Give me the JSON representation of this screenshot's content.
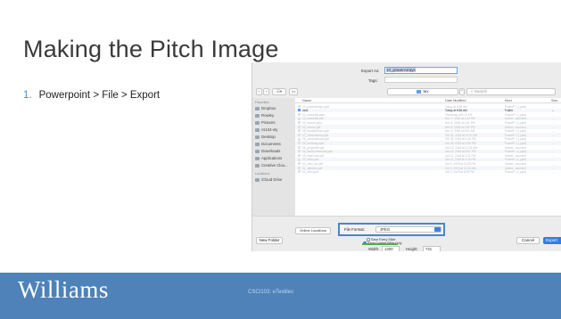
{
  "slide": {
    "title": "Making the Pitch Image",
    "bullet_number": "1.",
    "bullet_text": "Powerpoint > File > Export"
  },
  "dialog": {
    "export_as_label": "Export As:",
    "export_as_value": "10_powerArrays",
    "tags_label": "Tags:",
    "folder": "tex",
    "search_placeholder": "Search",
    "sidebar": {
      "favorites_header": "Favorites",
      "favorites": [
        "Dropbox",
        "Rowley",
        "Pictures",
        "cs134-sty",
        "Desktop",
        "Documents",
        "Downloads",
        "Applications",
        "Creative Clou..."
      ],
      "locations_header": "Locations",
      "locations": [
        "iCloud Drive"
      ]
    },
    "columns": {
      "name": "Name",
      "date": "Date Modified",
      "kind": "Kind",
      "size": "Size"
    },
    "files": [
      {
        "name": "10_powerArrays.pptx",
        "date": "Today at 8:58 AM",
        "kind": "PowerP...t (.pptx)",
        "size": "...",
        "highlight": false
      },
      {
        "name": "csd1",
        "date": "Today at 8:56 AM",
        "kind": "Folder",
        "size": "--",
        "highlight": true
      },
      {
        "name": "10_concepts.pptx",
        "date": "Yesterday at 8:13 PM",
        "kind": "PowerP...t (.pptx)",
        "size": "...",
        "highlight": false
      },
      {
        "name": "10_concepts.pdf",
        "date": "Nov 7, 2018 at 1:44 PM",
        "kind": "Adobe...ocument",
        "size": "...",
        "highlight": false
      },
      {
        "name": "09_lecture.pptx",
        "date": "Nov 5, 2018 at 1:51 PM",
        "kind": "PowerP...t (.pptx)",
        "size": "...",
        "highlight": false
      },
      {
        "name": "09_lecture.pdf",
        "date": "Nov 5, 2018 at 1:50 PM",
        "kind": "Adobe...ocument",
        "size": "...",
        "highlight": false
      },
      {
        "name": "08_breakItDown.pptx",
        "date": "Nov 4, 2018 at 8:51 AM",
        "kind": "PowerP...t (.pptx)",
        "size": "...",
        "highlight": false
      },
      {
        "name": "07_conventions.pptx",
        "date": "Oct 31, 2018 at 11:07 AM",
        "kind": "PowerP...t (.pptx)",
        "size": "...",
        "highlight": false
      },
      {
        "name": "06_conventional.pptx",
        "date": "Oct 30, 2018 at 4:26 PM",
        "kind": "PowerP...t (.pptx)",
        "size": "...",
        "highlight": false
      },
      {
        "name": "06_ecrisnap.pptx",
        "date": "Oct 28, 2018 at 4:58 PM",
        "kind": "PowerP...t (.pptx)",
        "size": "...",
        "highlight": false
      },
      {
        "name": "05_projectArt.pdf",
        "date": "Oct 18, 2018 at 11:24 AM",
        "kind": "Adobe...ocument",
        "size": "...",
        "highlight": false
      },
      {
        "name": "04_hardComments.pptx",
        "date": "Oct 16, 2018 at 8:07 PM",
        "kind": "PowerP...t (.pptx)",
        "size": "...",
        "highlight": false
      },
      {
        "name": "03_finalCode.pdf",
        "date": "Oct 11, 2018 at 1:21 PM",
        "kind": "Adobe...ocument",
        "size": "...",
        "highlight": false
      },
      {
        "name": "03_intro.pptx",
        "date": "Oct 11, 2018 at 1:16 PM",
        "kind": "PowerP...t (.pptx)",
        "size": "...",
        "highlight": false
      },
      {
        "name": "02_intro_arc.pdf",
        "date": "Oct 5, 2018 at 11:58 PM",
        "kind": "Adobe...ocument",
        "size": "...",
        "highlight": false
      },
      {
        "name": "01_syllabus.pdf",
        "date": "Oct 4, 2018 at 10:15 AM",
        "kind": "Adobe...ocument",
        "size": "...",
        "highlight": false
      },
      {
        "name": "01_intro.pptx",
        "date": "Oct 3, 2018 at 8:28 PM",
        "kind": "PowerP...t (.pptx)",
        "size": "...",
        "highlight": false
      }
    ],
    "online_locations": "Online Locations",
    "file_format_label": "File Format:",
    "file_format_value": "JPEG",
    "option_every_slide": "Save Every Slide",
    "option_current_slide": "Save Current Slide Only",
    "width_label": "Width:",
    "width_value": "1300",
    "height_label": "Height:",
    "height_value": "731",
    "new_folder": "New Folder",
    "cancel": "Cancel",
    "export": "Export"
  },
  "footer": {
    "logo": "Williams",
    "course": "CSCI103: eTextiles"
  },
  "colors": {
    "footer_bg": "#4e82b8",
    "accent_blue": "#2f7fe6",
    "highlight_box": "#4b86c8",
    "green_underline": "#4caf50",
    "orange_underline": "#f1b431"
  }
}
